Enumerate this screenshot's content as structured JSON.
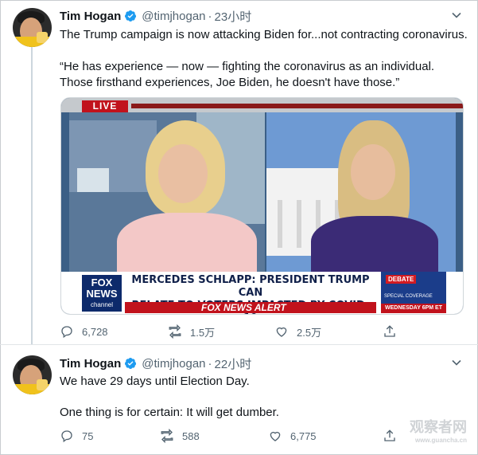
{
  "tweets": [
    {
      "name": "Tim Hogan",
      "handle": "@timjhogan",
      "separator": "·",
      "time": "23小时",
      "line1": "The Trump campaign is now attacking Biden for...not contracting coronavirus.",
      "line2": "“He has experience — now — fighting the coronavirus as an individual.",
      "line3": "Those firsthand experiences, Joe Biden, he doesn't have those.”",
      "replies": "6,728",
      "retweets": "1.5万",
      "likes": "2.5万"
    },
    {
      "name": "Tim Hogan",
      "handle": "@timjhogan",
      "separator": "·",
      "time": "22小时",
      "line1": "We have 29 days until Election Day.",
      "line2": "One thing is for certain: It will get dumber.",
      "replies": "75",
      "retweets": "588",
      "likes": "6,775"
    }
  ],
  "video": {
    "live_badge": "LIVE",
    "logo_line1": "FOX",
    "logo_line2": "NEWS",
    "logo_line3": "channel",
    "headline_line1": "MERCEDES SCHLAPP: PRESIDENT TRUMP CAN",
    "headline_line2": "RELATE TO VOTERS IMPACTED BY COVID-19",
    "alert": "FOX NEWS ALERT",
    "promo_title": "DEBATE",
    "promo_sub": "SPECIAL COVERAGE",
    "promo_time": "WEDNESDAY 6PM ET"
  },
  "watermark": {
    "text": "观察者网",
    "url": "www.guancha.cn"
  },
  "icons": [
    "verified-badge-icon",
    "caret-down-icon",
    "reply-icon",
    "retweet-icon",
    "like-icon",
    "share-icon"
  ],
  "colors": {
    "verified": "#1d9bf0",
    "secondary_text": "#536471",
    "fox_red": "#c1121c",
    "fox_blue": "#0d2a6b"
  }
}
